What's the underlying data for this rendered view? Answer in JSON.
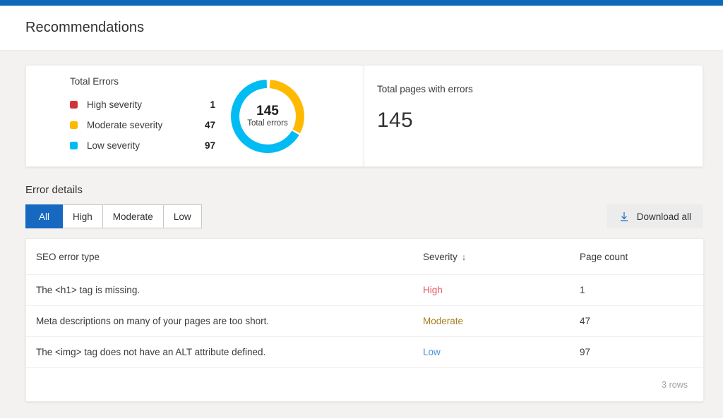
{
  "theme": {
    "accent_bar": "#1068b8",
    "primary": "#1668c1",
    "high": "#d13438",
    "moderate": "#ffb900",
    "low": "#00bcf2",
    "page_bg": "#f3f2f1"
  },
  "header": {
    "title": "Recommendations"
  },
  "summary": {
    "errors_card": {
      "legend_title": "Total Errors",
      "items": [
        {
          "label": "High severity",
          "value": "1",
          "color": "#d13438"
        },
        {
          "label": "Moderate severity",
          "value": "47",
          "color": "#ffb900"
        },
        {
          "label": "Low severity",
          "value": "97",
          "color": "#00bcf2"
        }
      ],
      "donut": {
        "total": "145",
        "caption": "Total errors"
      }
    },
    "pages_card": {
      "label": "Total pages with errors",
      "value": "145"
    }
  },
  "chart_data": {
    "type": "pie",
    "title": "Total Errors",
    "center_value": "145",
    "center_label": "Total errors",
    "categories": [
      "High severity",
      "Moderate severity",
      "Low severity"
    ],
    "values": [
      1,
      47,
      97
    ],
    "colors": [
      "#d13438",
      "#ffb900",
      "#00bcf2"
    ],
    "total": 145,
    "legend_position": "left",
    "donut_hole_ratio": 0.78
  },
  "error_details": {
    "section_title": "Error details",
    "filters": [
      {
        "label": "All",
        "selected": true
      },
      {
        "label": "High",
        "selected": false
      },
      {
        "label": "Moderate",
        "selected": false
      },
      {
        "label": "Low",
        "selected": false
      }
    ],
    "download_label": "Download all",
    "download_icon": "download-icon",
    "columns": {
      "type": "SEO error type",
      "severity": "Severity",
      "severity_sort_icon": "↓",
      "count": "Page count"
    },
    "rows": [
      {
        "type": "The <h1> tag is missing.",
        "severity": "High",
        "severity_class": "sev-high",
        "count": "1"
      },
      {
        "type": "Meta descriptions on many of your pages are too short.",
        "severity": "Moderate",
        "severity_class": "sev-moderate",
        "count": "47"
      },
      {
        "type": "The <img> tag does not have an ALT attribute defined.",
        "severity": "Low",
        "severity_class": "sev-low",
        "count": "97"
      }
    ],
    "footer": "3 rows"
  }
}
